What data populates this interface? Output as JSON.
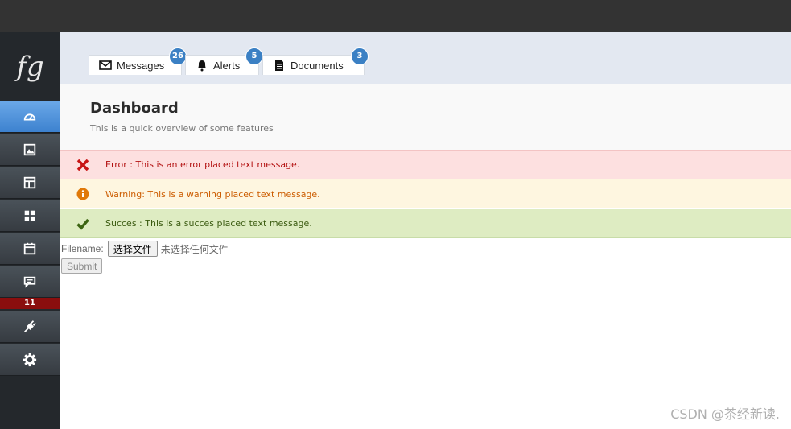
{
  "logo": {
    "text": "fg"
  },
  "sidebar": {
    "items": [
      {
        "icon": "dashboard-icon",
        "active": true
      },
      {
        "icon": "image-icon"
      },
      {
        "icon": "layout-icon"
      },
      {
        "icon": "grid-icon"
      },
      {
        "icon": "calendar-icon"
      },
      {
        "icon": "chat-icon"
      },
      {
        "icon": "plug-icon"
      },
      {
        "icon": "gear-icon"
      }
    ],
    "chat_count": "11"
  },
  "tabs": [
    {
      "label": "Messages",
      "count": "26",
      "icon": "envelope-icon"
    },
    {
      "label": "Alerts",
      "count": "5",
      "icon": "bell-icon"
    },
    {
      "label": "Documents",
      "count": "3",
      "icon": "document-icon"
    }
  ],
  "page": {
    "title": "Dashboard",
    "subtitle": "This is a quick overview of some features"
  },
  "messages": {
    "error": "Error : This is an error placed text message.",
    "warning": "Warning: This is a warning placed text message.",
    "success": "Succes : This is a succes placed text message."
  },
  "form": {
    "filename_label": "Filename:",
    "choose_button": "选择文件",
    "no_file": "未选择任何文件",
    "submit": "Submit"
  },
  "watermark": "CSDN @茶经新读.",
  "colors": {
    "error": "#b31010",
    "warning": "#cc5c00",
    "success": "#3a5a10",
    "accent": "#3b80c4"
  }
}
